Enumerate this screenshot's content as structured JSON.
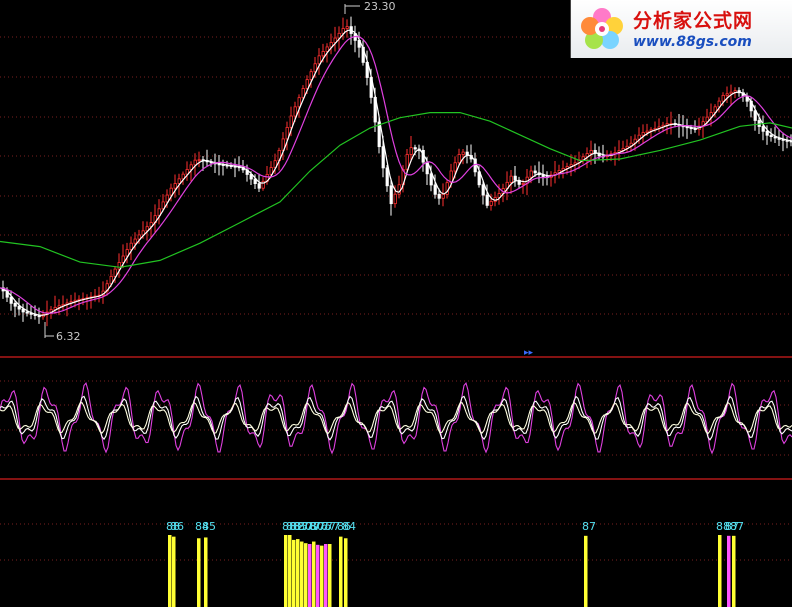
{
  "watermark": {
    "name": "分析家公式网",
    "url": "www.88gs.com"
  },
  "chart_data": [
    {
      "type": "candlestick",
      "panel": "price",
      "annotations": {
        "high_label": "23.30",
        "low_label": "6.32"
      },
      "colors": {
        "up": "#ff3030",
        "down": "#ffffff",
        "ma_short": "#ffffff",
        "ma_mid": "#e040e0",
        "ma_long": "#22c322"
      },
      "price_path": [
        [
          0,
          8.0
        ],
        [
          10,
          7.1
        ],
        [
          22,
          6.6
        ],
        [
          38,
          6.32
        ],
        [
          55,
          6.9
        ],
        [
          75,
          7.3
        ],
        [
          100,
          7.6
        ],
        [
          115,
          9.2
        ],
        [
          130,
          10.6
        ],
        [
          150,
          11.8
        ],
        [
          170,
          13.8
        ],
        [
          195,
          15.5
        ],
        [
          215,
          15.2
        ],
        [
          240,
          15.0
        ],
        [
          258,
          13.8
        ],
        [
          275,
          15.5
        ],
        [
          290,
          18.0
        ],
        [
          305,
          20.0
        ],
        [
          318,
          21.5
        ],
        [
          335,
          22.6
        ],
        [
          345,
          23.3
        ],
        [
          358,
          22.0
        ],
        [
          368,
          19.8
        ],
        [
          380,
          15.5
        ],
        [
          390,
          12.9
        ],
        [
          398,
          14.0
        ],
        [
          408,
          16.2
        ],
        [
          418,
          16.0
        ],
        [
          425,
          14.8
        ],
        [
          433,
          13.5
        ],
        [
          440,
          13.1
        ],
        [
          450,
          14.8
        ],
        [
          460,
          16.0
        ],
        [
          470,
          15.5
        ],
        [
          478,
          14.0
        ],
        [
          486,
          12.8
        ],
        [
          493,
          13.2
        ],
        [
          500,
          13.6
        ],
        [
          510,
          14.5
        ],
        [
          520,
          13.9
        ],
        [
          530,
          14.8
        ],
        [
          545,
          14.4
        ],
        [
          560,
          14.9
        ],
        [
          575,
          15.3
        ],
        [
          590,
          16.0
        ],
        [
          600,
          15.6
        ],
        [
          615,
          15.9
        ],
        [
          628,
          16.3
        ],
        [
          640,
          17.0
        ],
        [
          655,
          17.3
        ],
        [
          668,
          17.6
        ],
        [
          680,
          17.4
        ],
        [
          695,
          17.2
        ],
        [
          710,
          18.2
        ],
        [
          722,
          19.2
        ],
        [
          735,
          19.5
        ],
        [
          745,
          19.0
        ],
        [
          755,
          17.6
        ],
        [
          765,
          16.9
        ],
        [
          780,
          16.6
        ],
        [
          792,
          16.5
        ]
      ],
      "ma_long_path": [
        [
          0,
          10.7
        ],
        [
          40,
          10.4
        ],
        [
          80,
          9.5
        ],
        [
          120,
          9.2
        ],
        [
          160,
          9.6
        ],
        [
          200,
          10.6
        ],
        [
          240,
          11.8
        ],
        [
          280,
          13.0
        ],
        [
          310,
          14.8
        ],
        [
          340,
          16.3
        ],
        [
          370,
          17.3
        ],
        [
          400,
          17.9
        ],
        [
          430,
          18.2
        ],
        [
          460,
          18.2
        ],
        [
          490,
          17.7
        ],
        [
          520,
          16.9
        ],
        [
          550,
          16.1
        ],
        [
          580,
          15.4
        ],
        [
          620,
          15.5
        ],
        [
          660,
          16.0
        ],
        [
          700,
          16.6
        ],
        [
          740,
          17.4
        ],
        [
          770,
          17.6
        ],
        [
          792,
          17.3
        ]
      ],
      "ylim": [
        5.2,
        24.4
      ]
    },
    {
      "type": "line",
      "panel": "oscillator",
      "series": [
        {
          "color": "#e040e0",
          "period": 38,
          "amplitude": 0.45
        },
        {
          "color": "#ffffff",
          "period": 38,
          "amplitude": 0.28
        },
        {
          "color": "#ffffe0",
          "period": 38,
          "amplitude": 0.2
        }
      ],
      "ylim": [
        -1,
        1
      ]
    },
    {
      "type": "bar",
      "panel": "signals",
      "bars": [
        {
          "x": 168,
          "color": "#ffff33",
          "label": "88",
          "value": 88
        },
        {
          "x": 172,
          "color": "#ffff33",
          "label": "86",
          "value": 86
        },
        {
          "x": 197,
          "color": "#ffff33",
          "label": "84",
          "value": 84
        },
        {
          "x": 204,
          "color": "#ffff33",
          "label": "85",
          "value": 85
        },
        {
          "x": 284,
          "color": "#ffff33",
          "label": "88",
          "value": 88
        },
        {
          "x": 288,
          "color": "#ffff33",
          "label": "88",
          "value": 88
        },
        {
          "x": 292,
          "color": "#ffff33",
          "label": "82",
          "value": 82
        },
        {
          "x": 296,
          "color": "#ffff33",
          "label": "83",
          "value": 83
        },
        {
          "x": 300,
          "color": "#ffff33",
          "label": "80",
          "value": 80
        },
        {
          "x": 304,
          "color": "#ffff33",
          "label": "78",
          "value": 78
        },
        {
          "x": 308,
          "color": "#ff55ff",
          "label": "77",
          "value": 77
        },
        {
          "x": 312,
          "color": "#ffff33",
          "label": "80",
          "value": 80
        },
        {
          "x": 316,
          "color": "#ff55ff",
          "label": "76",
          "value": 76
        },
        {
          "x": 320,
          "color": "#ffff33",
          "label": "75",
          "value": 75
        },
        {
          "x": 324,
          "color": "#ff55ff",
          "label": "77",
          "value": 77
        },
        {
          "x": 328,
          "color": "#ffff33",
          "label": "77",
          "value": 77
        },
        {
          "x": 339,
          "color": "#ffff33",
          "label": "86",
          "value": 86
        },
        {
          "x": 344,
          "color": "#ffff33",
          "label": "84",
          "value": 84
        },
        {
          "x": 584,
          "color": "#ffff33",
          "label": "87",
          "value": 87
        },
        {
          "x": 718,
          "color": "#ffff33",
          "label": "88",
          "value": 88
        },
        {
          "x": 727,
          "color": "#ff55ff",
          "label": "87",
          "value": 87
        },
        {
          "x": 732,
          "color": "#ffff33",
          "label": "87",
          "value": 87
        }
      ],
      "ylim": [
        0,
        88
      ]
    }
  ]
}
